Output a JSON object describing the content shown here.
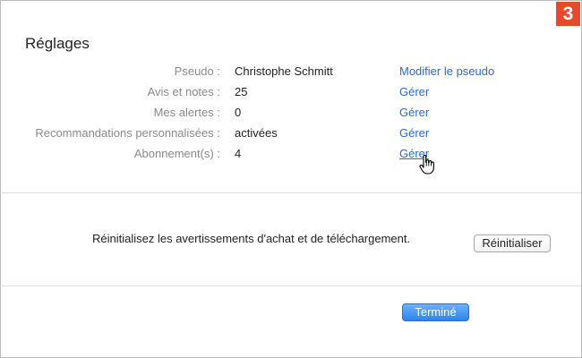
{
  "badge": "3",
  "title": "Réglages",
  "account_rows": [
    {
      "label": "Pseudo :",
      "value": "Christophe Schmitt",
      "action": "Modifier le pseudo"
    },
    {
      "label": "Avis et notes :",
      "value": "25",
      "action": "Gérer"
    },
    {
      "label": "Mes alertes :",
      "value": "0",
      "action": "Gérer"
    },
    {
      "label": "Recommandations personnalisées :",
      "value": "activées",
      "action": "Gérer"
    },
    {
      "label": "Abonnement(s) :",
      "value": "4",
      "action": "Gérer"
    }
  ],
  "reset": {
    "text": "Réinitialisez les avertissements d'achat et de téléchargement.",
    "button": "Réinitialiser"
  },
  "done_button": "Terminé",
  "colors": {
    "badge": "#e8492a",
    "link": "#2a6ad6",
    "primary_button": "#2d84ee"
  },
  "icons": {
    "cursor": "hand-pointer-icon"
  }
}
